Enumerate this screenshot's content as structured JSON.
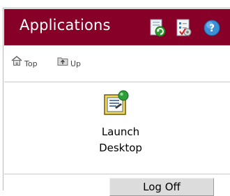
{
  "header": {
    "title": "Applications",
    "icons": [
      "refresh-icon",
      "preferences-icon",
      "help-icon"
    ],
    "background_color": "#870028"
  },
  "nav": {
    "top_label": "Top",
    "up_label": "Up"
  },
  "apps": [
    {
      "label": "Launch\nDesktop",
      "icon": "launch-desktop-icon"
    }
  ],
  "footer": {
    "logoff_label": "Log Off"
  }
}
